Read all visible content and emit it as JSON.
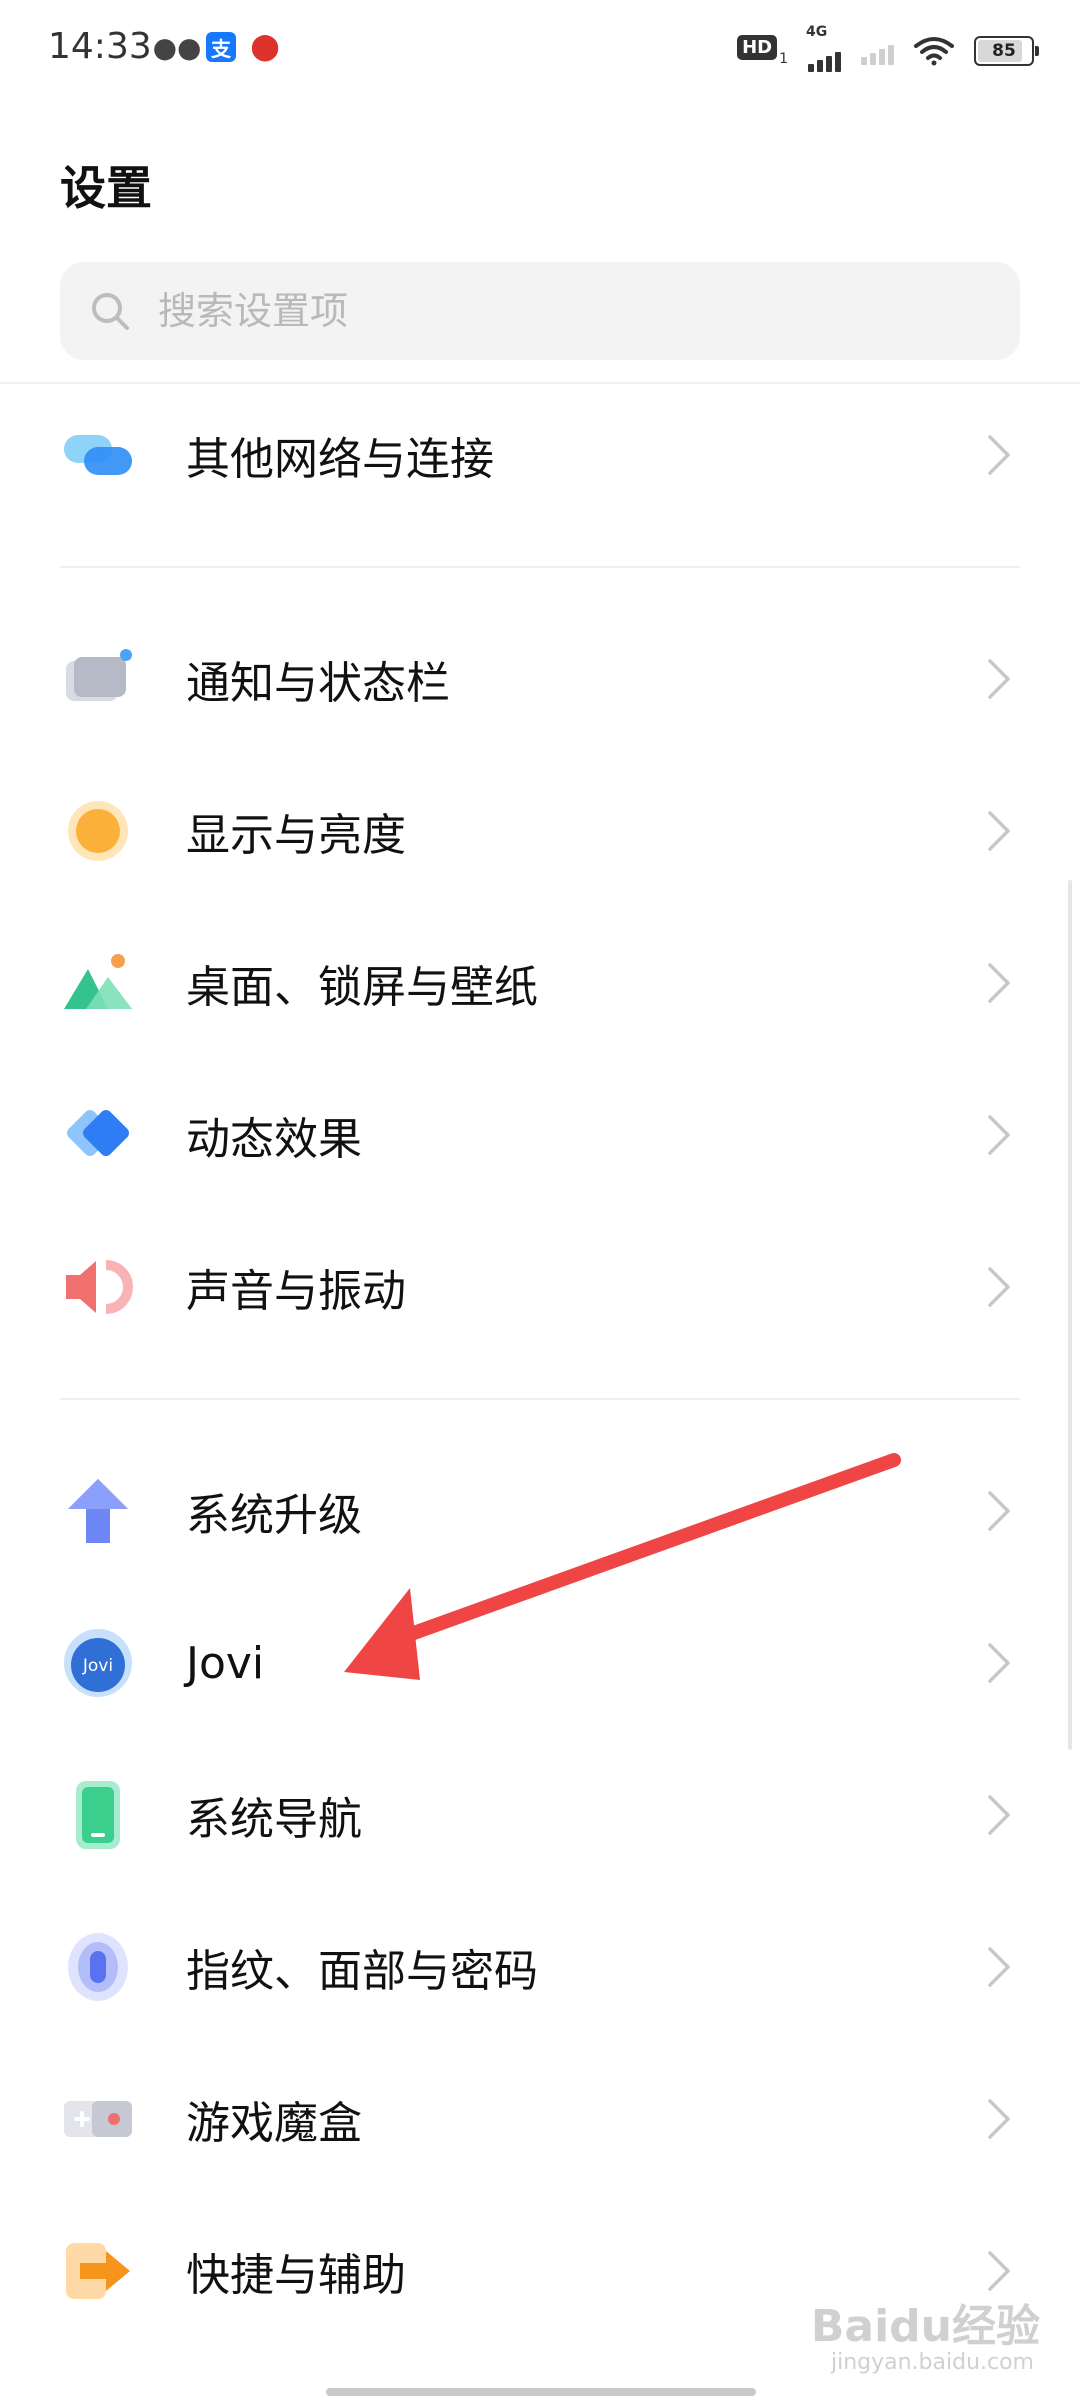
{
  "status_bar": {
    "time": "14:33",
    "hd_label": "HD",
    "hd_sub": "1",
    "network_label": "4G",
    "battery_level": "85",
    "battery_fraction": 0.85
  },
  "header": {
    "title": "设置",
    "search_placeholder": "搜索设置项"
  },
  "settings": {
    "items": [
      {
        "label": "其他网络与连接",
        "icon": "network-connection-icon"
      },
      {
        "label": "通知与状态栏",
        "icon": "notification-icon"
      },
      {
        "label": "显示与亮度",
        "icon": "display-brightness-icon"
      },
      {
        "label": "桌面、锁屏与壁纸",
        "icon": "wallpaper-icon"
      },
      {
        "label": "动态效果",
        "icon": "dynamic-effects-icon"
      },
      {
        "label": "声音与振动",
        "icon": "sound-icon"
      },
      {
        "label": "系统升级",
        "icon": "system-upgrade-icon"
      },
      {
        "label": "Jovi",
        "icon": "jovi-icon",
        "icon_text": "Jovi"
      },
      {
        "label": "系统导航",
        "icon": "system-navigation-icon"
      },
      {
        "label": "指纹、面部与密码",
        "icon": "fingerprint-icon"
      },
      {
        "label": "游戏魔盒",
        "icon": "game-box-icon"
      },
      {
        "label": "快捷与辅助",
        "icon": "shortcuts-icon"
      }
    ]
  },
  "watermark": {
    "text": "Baidu经验",
    "sub": "jingyan.baidu.com"
  },
  "colors": {
    "accent_blue": "#2f8df5",
    "arrow_red": "#f04545"
  }
}
